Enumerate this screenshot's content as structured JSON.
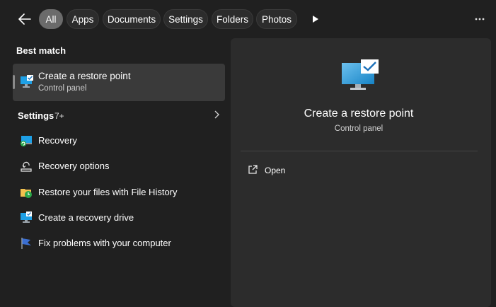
{
  "filters": [
    {
      "label": "All",
      "active": true
    },
    {
      "label": "Apps",
      "active": false
    },
    {
      "label": "Documents",
      "active": false
    },
    {
      "label": "Settings",
      "active": false
    },
    {
      "label": "Folders",
      "active": false
    },
    {
      "label": "Photos",
      "active": false
    }
  ],
  "best_match": {
    "heading": "Best match",
    "title": "Create a restore point",
    "subtitle": "Control panel"
  },
  "settings_section": {
    "heading": "Settings",
    "count": "7+"
  },
  "results": [
    {
      "label": "Recovery",
      "icon": "recovery-icon"
    },
    {
      "label": "Recovery options",
      "icon": "recovery-options-icon"
    },
    {
      "label": "Restore your files with File History",
      "icon": "file-history-icon"
    },
    {
      "label": "Create a recovery drive",
      "icon": "recovery-drive-icon"
    },
    {
      "label": "Fix problems with your computer",
      "icon": "troubleshoot-flag-icon"
    }
  ],
  "preview": {
    "title": "Create a restore point",
    "subtitle": "Control panel",
    "actions": [
      {
        "label": "Open",
        "icon": "open-external-icon"
      }
    ]
  },
  "colors": {
    "background": "#202020",
    "panel": "#2c2c2c",
    "selected": "#3a3a3a",
    "monitor_blue": "#1ea0e6"
  }
}
